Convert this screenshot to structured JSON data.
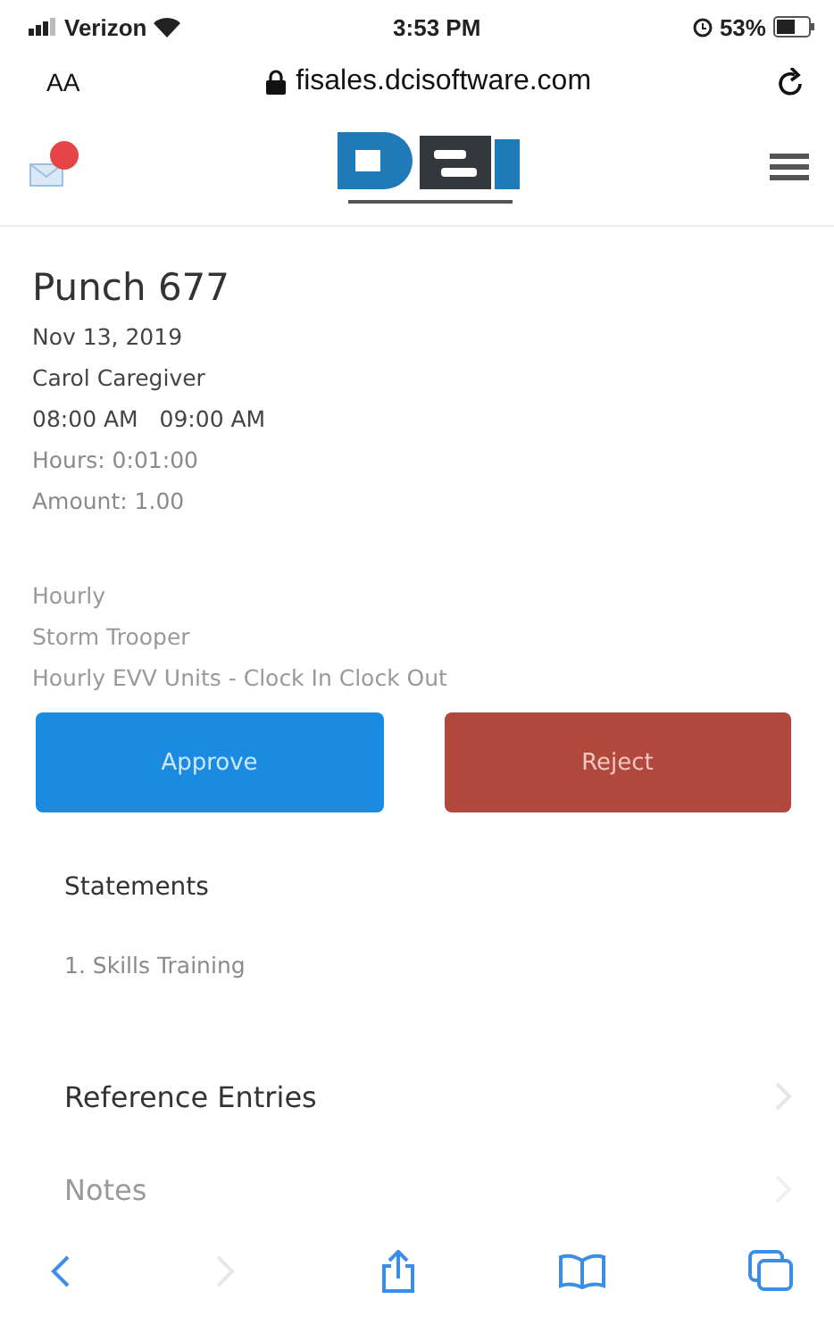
{
  "status_bar": {
    "carrier": "Verizon",
    "time": "3:53 PM",
    "battery": "53%"
  },
  "address_bar": {
    "text_size": "AA",
    "url": "fisales.dcisoftware.com"
  },
  "punch": {
    "title": "Punch 677",
    "date": "Nov 13, 2019",
    "caregiver": "Carol Caregiver",
    "times": "08:00 AM   09:00 AM",
    "hours": "Hours: 0:01:00",
    "amount": "Amount: 1.00",
    "pay_type": "Hourly",
    "client": "Storm Trooper",
    "service": "Hourly EVV Units - Clock In Clock Out"
  },
  "buttons": [
    {
      "label": "Approve",
      "kind": "approve"
    },
    {
      "label": "Reject",
      "kind": "reject"
    }
  ],
  "statements": {
    "title": "Statements",
    "items": [
      "1. Skills Training"
    ]
  },
  "sections": [
    {
      "label": "Reference Entries",
      "disabled": false
    },
    {
      "label": "Notes",
      "disabled": true
    }
  ],
  "toolbar": {
    "forward_disabled": true
  }
}
